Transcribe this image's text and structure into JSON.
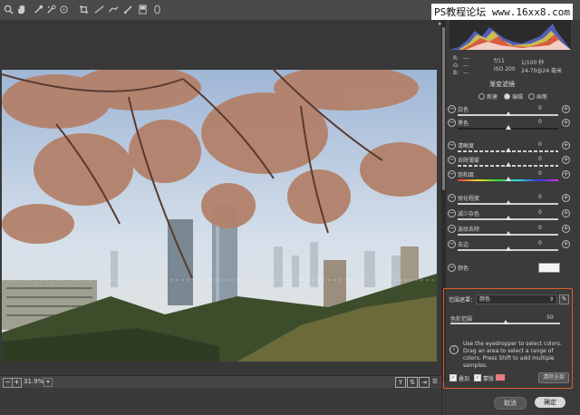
{
  "watermark": "PS教程论坛 www.16xx8.com",
  "toolbar": {
    "tools": [
      "zoom-icon",
      "hand-icon",
      "white-balance-icon",
      "color-sampler-icon",
      "target-adjust-icon",
      "crop-icon",
      "straighten-icon",
      "spot-removal-icon",
      "red-eye-icon",
      "adjustment-brush-icon",
      "graduated-filter-icon",
      "radial-filter-icon"
    ]
  },
  "readout": {
    "r_label": "R:",
    "g_label": "G:",
    "b_label": "B:",
    "r_value": "---",
    "g_value": "---",
    "b_value": "---",
    "aperture": "f/11",
    "shutter": "1/100 秒",
    "iso": "ISO 200",
    "lens": "24-70@24 毫米"
  },
  "panel": {
    "title": "渐变滤镜",
    "modes": [
      "新建",
      "编辑",
      "画笔"
    ],
    "selected_mode": "编辑"
  },
  "sliders": [
    {
      "label": "白色",
      "value": "0"
    },
    {
      "label": "黑色",
      "value": "0"
    },
    {
      "label": "清晰度",
      "value": "0"
    },
    {
      "label": "去除薄雾",
      "value": "0"
    },
    {
      "label": "饱和度",
      "value": "0"
    },
    {
      "label": "锐化程度",
      "value": "0"
    },
    {
      "label": "减少杂色",
      "value": "0"
    },
    {
      "label": "波纹去除",
      "value": "0"
    },
    {
      "label": "去边",
      "value": "0"
    }
  ],
  "color": {
    "label": "颜色"
  },
  "range_mask": {
    "label": "范围遮罩：",
    "selected": "颜色",
    "color_range_label": "色彩范围",
    "color_range_value": "50",
    "color_range_fraction": 0.5,
    "info": "Use the eyedropper to select colors. Drag an area to select a range of colors. Press Shift to add multiple samples.",
    "overlay_label": "叠加",
    "mask_label": "蒙版",
    "overlay_color": "#e87b82",
    "clear_all": "清除全部"
  },
  "status": {
    "zoom": "31.9%"
  },
  "buttons": {
    "cancel": "取消",
    "ok": "确定"
  },
  "colors": {
    "accent": "#e45a2b"
  }
}
